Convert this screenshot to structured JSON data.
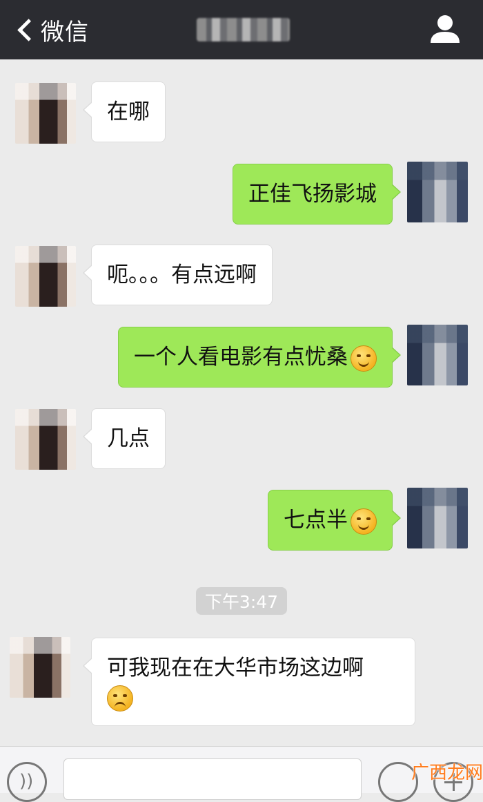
{
  "header": {
    "back_label": "微信",
    "chat_title": "",
    "profile_icon": "person-icon"
  },
  "messages": [
    {
      "side": "left",
      "text": "在哪"
    },
    {
      "side": "right",
      "text": "正佳飞扬影城"
    },
    {
      "side": "left",
      "text": "呃。。。有点远啊"
    },
    {
      "side": "right",
      "text": "一个人看电影有点忧桑",
      "emoji": "sweat-laugh-emoji"
    },
    {
      "side": "left",
      "text": "几点"
    },
    {
      "side": "right",
      "text": "七点半",
      "emoji": "smirk-emoji"
    },
    {
      "side": "left",
      "text": "可我现在在大华市场这边啊",
      "emoji": "sad-emoji"
    }
  ],
  "timestamp": "下午3:47",
  "input_bar": {
    "voice_icon": "voice-icon",
    "emoji_icon": "emoji-icon",
    "plus_icon": "plus-icon"
  },
  "watermark": {
    "text": "广西龙网"
  },
  "colors": {
    "header_bg": "#2b2c31",
    "chat_bg": "#ebebeb",
    "sent_bubble": "#9ee858",
    "received_bubble": "#ffffff"
  }
}
